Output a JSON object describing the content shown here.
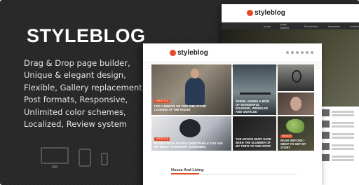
{
  "promo": {
    "logo": "STYLEBLOG",
    "features": [
      "Drag & Drop page builder,",
      "Unique & elegant design,",
      "Flexible, Gallery replacement,",
      "Post formats, Responsive,",
      "Unlimited color schemes,",
      "Localized, Review system"
    ]
  },
  "mockup": {
    "logo_text": "styleblog",
    "nav": [
      "home",
      "page builder",
      "Shortcodes",
      "templates",
      "contact",
      "blog",
      "purchase"
    ],
    "tiles": [
      {
        "tag": "LIFESTYLE",
        "caption": "FOR A MINUTE OR TWO SHE STOOD LOOKING AT THE HOUSE"
      },
      {
        "caption": "THERE, AMONG A BOW OF WONDERFUL ROUNDED, WRINKLED AND GNARLED"
      },
      {
        "tag": "LIFESTYLE",
        "caption": "ROGER SMITH INVITES CHRISTIANS & YOU ASK ME WHILE 'INTERVIEW' SCREENING"
      },
      {
        "caption": "THE ADVICE MUST HAVE BEEN THE SLUMBER OF MY TRIPS TO THE DOOR"
      },
      {
        "tag": "DESIGN",
        "caption": "RIGHT BEFORE I WENT TO GET MY STORY"
      }
    ],
    "section_title": "House And Living"
  }
}
